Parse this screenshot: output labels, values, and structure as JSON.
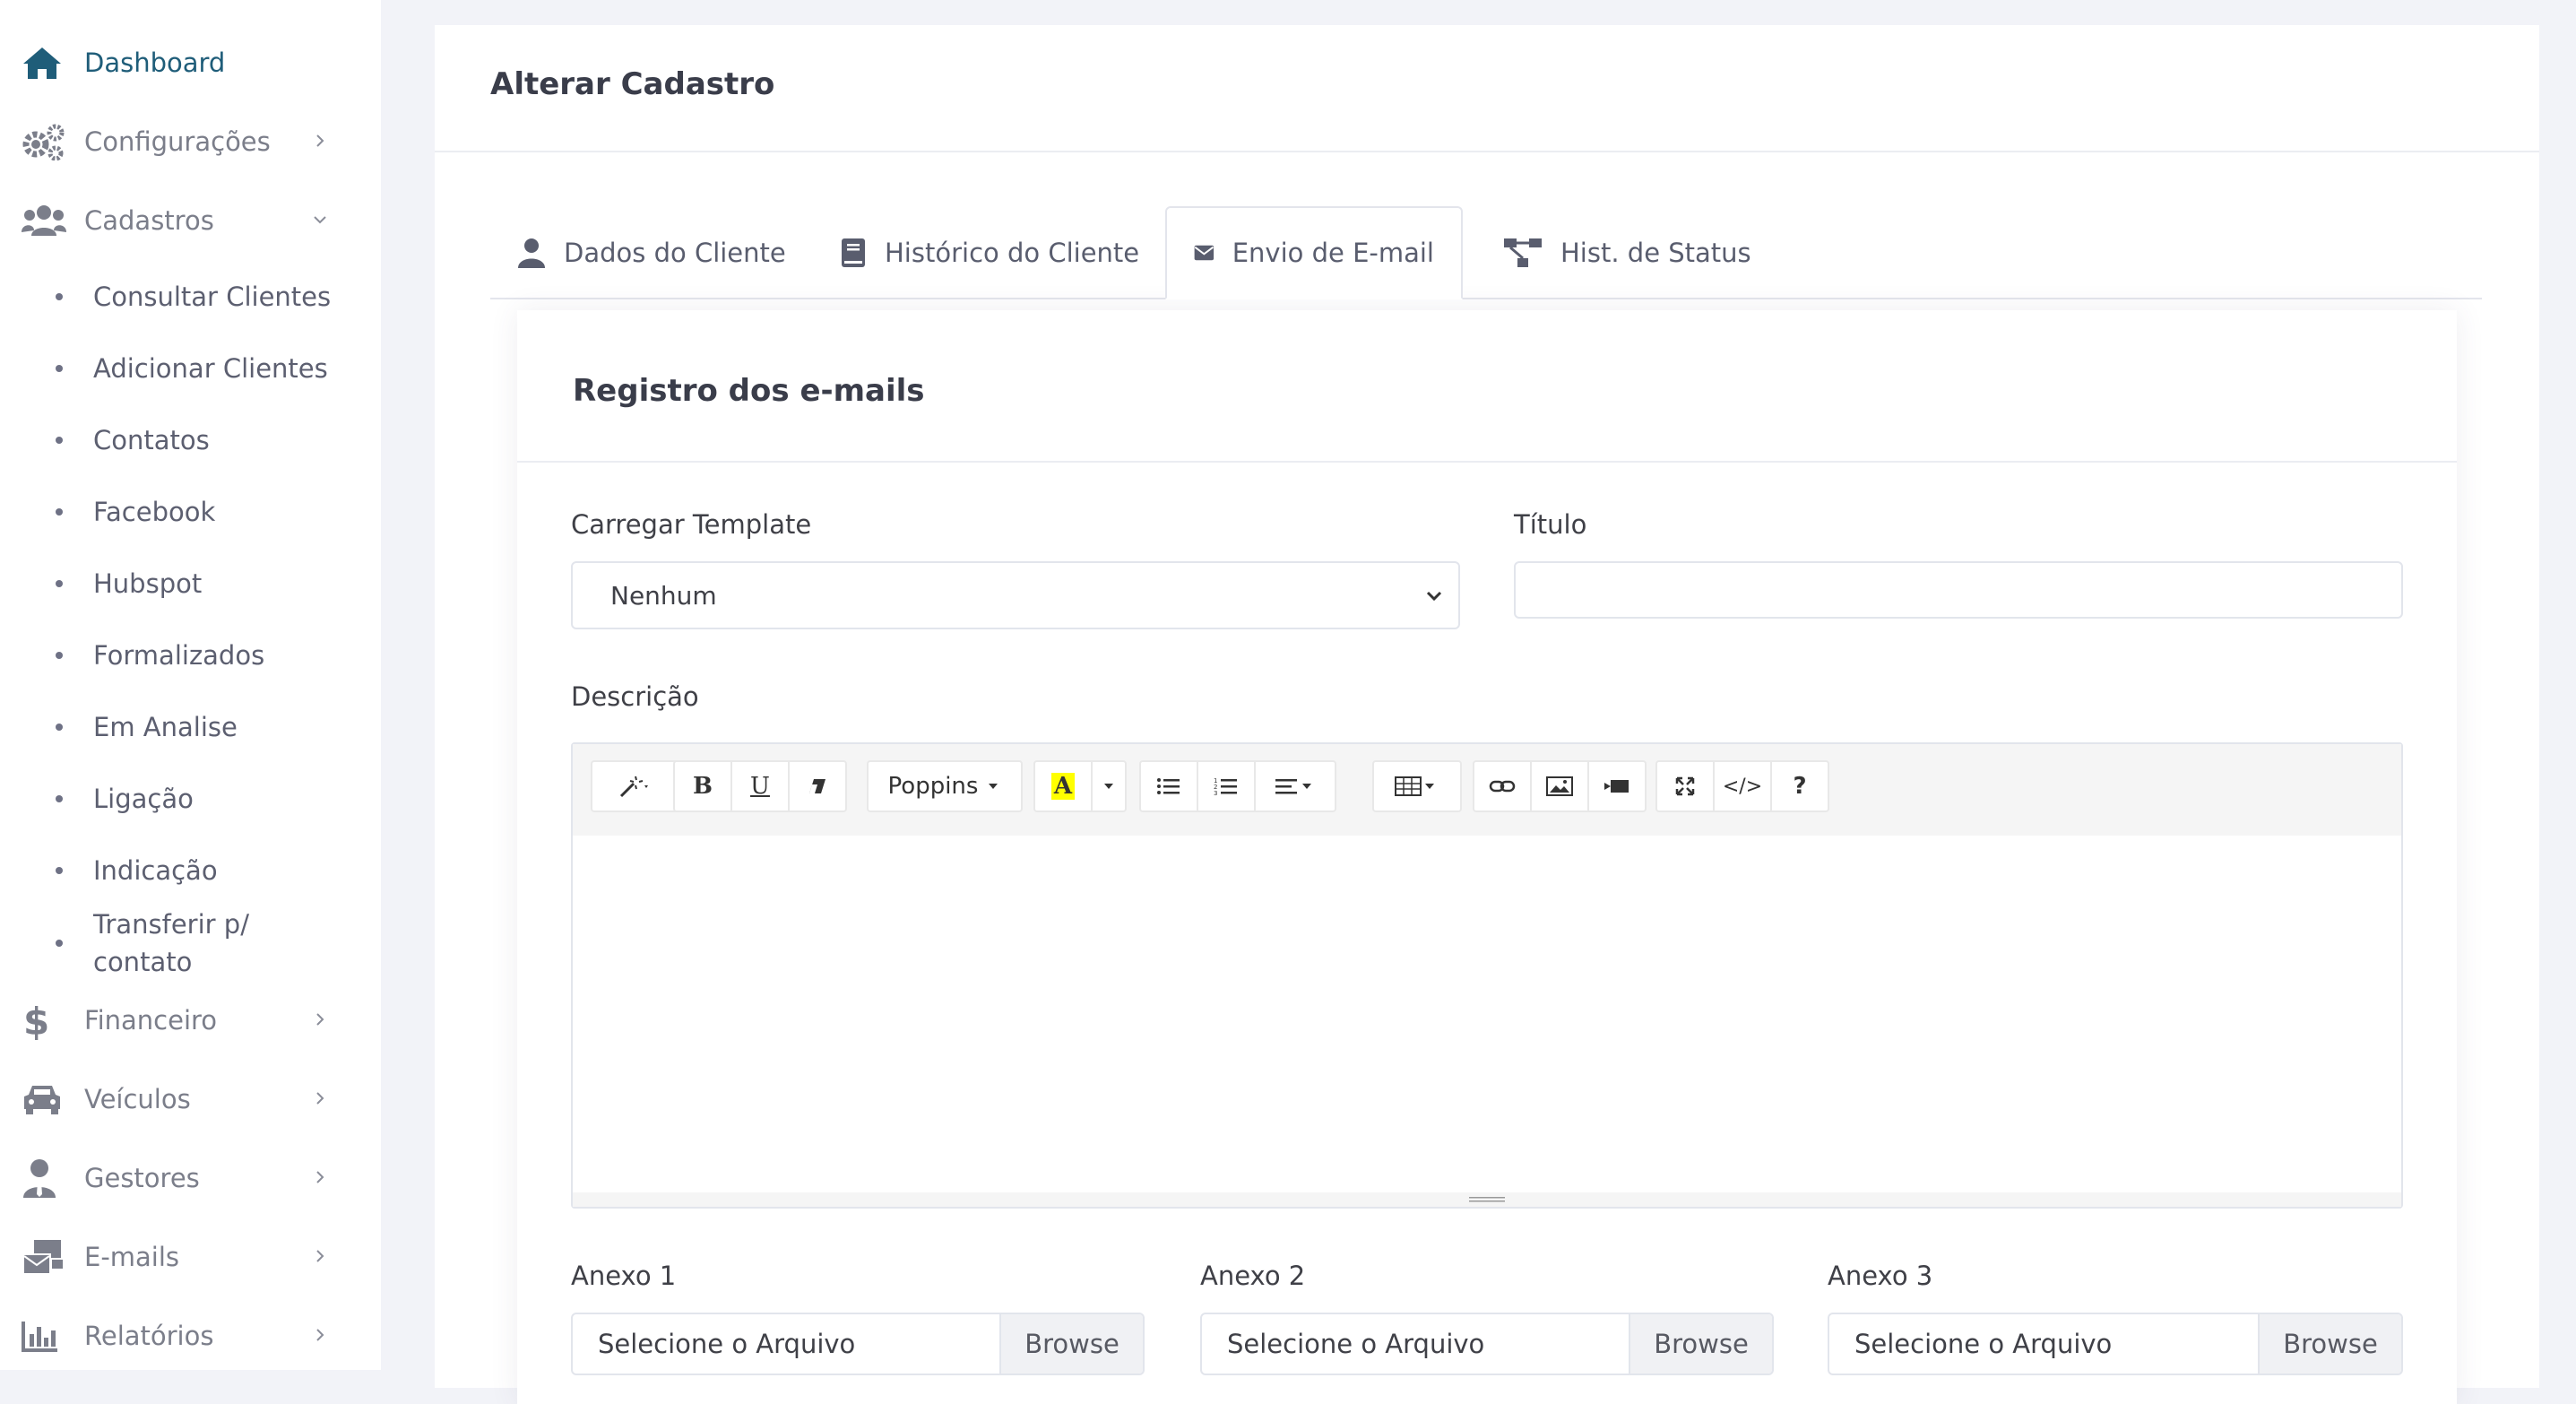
{
  "sidebar": {
    "items": [
      {
        "label": "Dashboard",
        "icon": "home-icon",
        "active": true
      },
      {
        "label": "Configurações",
        "icon": "gears-icon",
        "chevron": "right"
      },
      {
        "label": "Cadastros",
        "icon": "users-icon",
        "chevron": "down"
      },
      {
        "label": "Financeiro",
        "icon": "dollar-icon",
        "chevron": "right"
      },
      {
        "label": "Veículos",
        "icon": "car-icon",
        "chevron": "right"
      },
      {
        "label": "Gestores",
        "icon": "user-tie-icon",
        "chevron": "right"
      },
      {
        "label": "E-mails",
        "icon": "mail-bulk-icon",
        "chevron": "right"
      },
      {
        "label": "Relatórios",
        "icon": "bar-chart-icon",
        "chevron": "right"
      }
    ],
    "subitems": [
      {
        "label": "Consultar Clientes"
      },
      {
        "label": "Adicionar Clientes"
      },
      {
        "label": "Contatos"
      },
      {
        "label": "Facebook"
      },
      {
        "label": "Hubspot"
      },
      {
        "label": "Formalizados"
      },
      {
        "label": "Em Analise"
      },
      {
        "label": "Ligação"
      },
      {
        "label": "Indicação"
      },
      {
        "label": "Transferir p/ contato"
      }
    ]
  },
  "page": {
    "title": "Alterar Cadastro"
  },
  "tabs": [
    {
      "label": "Dados do Cliente",
      "icon": "user-icon"
    },
    {
      "label": "Histórico do Cliente",
      "icon": "book-icon"
    },
    {
      "label": "Envio de E-mail",
      "icon": "envelope-icon",
      "active": true
    },
    {
      "label": "Hist. de Status",
      "icon": "sitemap-icon"
    }
  ],
  "email_form": {
    "title": "Registro dos e-mails",
    "template_label": "Carregar Template",
    "template_value": "Nenhum",
    "titulo_label": "Título",
    "titulo_value": "",
    "descricao_label": "Descrição",
    "toolbar": {
      "style": "magic-icon",
      "bold": "B",
      "underline": "U",
      "clear_format": "eraser-icon",
      "font_name": "Poppins",
      "color_letter": "A",
      "highlight_color": "#ffff00",
      "help": "?",
      "code": "</>"
    },
    "attachments": [
      {
        "label": "Anexo 1",
        "placeholder": "Selecione o Arquivo",
        "browse": "Browse"
      },
      {
        "label": "Anexo 2",
        "placeholder": "Selecione o Arquivo",
        "browse": "Browse"
      },
      {
        "label": "Anexo 3",
        "placeholder": "Selecione o Arquivo",
        "browse": "Browse"
      }
    ]
  },
  "colors": {
    "brand": "#1f5d79",
    "sidebar_icon": "#7b7e8a",
    "background": "#f2f3f8"
  }
}
